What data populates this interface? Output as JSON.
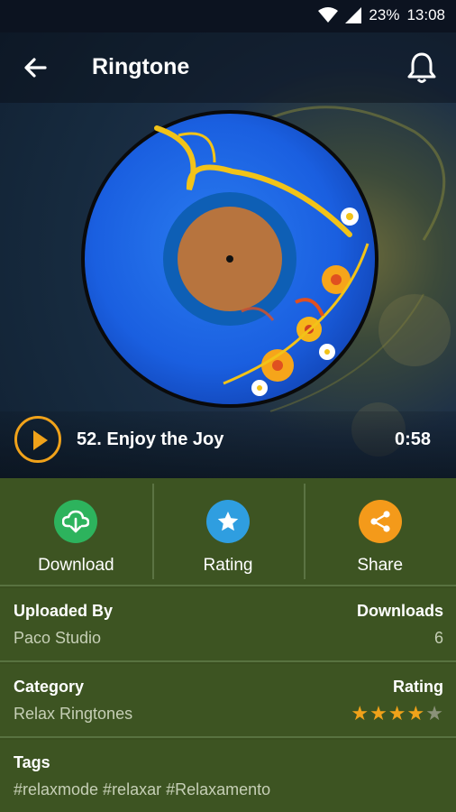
{
  "status_bar": {
    "battery": "23%",
    "time": "13:08"
  },
  "toolbar": {
    "title": "Ringtone"
  },
  "player": {
    "song_title": "52. Enjoy the Joy",
    "duration": "0:58"
  },
  "actions": [
    {
      "label": "Download",
      "icon": "cloud-download-icon",
      "color": "#2db35d"
    },
    {
      "label": "Rating",
      "icon": "star-icon",
      "color": "#2f9ee0"
    },
    {
      "label": "Share",
      "icon": "share-icon",
      "color": "#f49a1a"
    }
  ],
  "details": {
    "uploaded_by_label": "Uploaded By",
    "uploaded_by_value": "Paco Studio",
    "downloads_label": "Downloads",
    "downloads_value": "6",
    "category_label": "Category",
    "category_value": "Relax Ringtones",
    "rating_label": "Rating",
    "rating_stars": 4,
    "rating_max": 5,
    "tags_label": "Tags",
    "tags_value": "#relaxmode #relaxar #Relaxamento"
  },
  "colors": {
    "accent": "#f0a21a",
    "panel": "#3d5422"
  }
}
